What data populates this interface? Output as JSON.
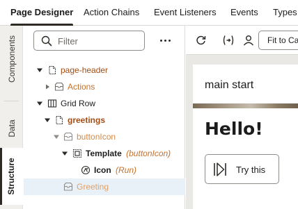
{
  "tabs": [
    {
      "label": "Page Designer",
      "active": true
    },
    {
      "label": "Action Chains",
      "active": false
    },
    {
      "label": "Event Listeners",
      "active": false
    },
    {
      "label": "Events",
      "active": false
    },
    {
      "label": "Types",
      "active": false
    }
  ],
  "rail": [
    {
      "label": "Components",
      "active": false
    },
    {
      "label": "Data",
      "active": false
    },
    {
      "label": "Structure",
      "active": true
    }
  ],
  "filter": {
    "placeholder": "Filter",
    "value": ""
  },
  "more_icon": "ellipsis-icon",
  "tree": [
    {
      "label": "page-header",
      "sub": "",
      "icon": "page-icon",
      "toggle": "expanded",
      "style": "orange-bold"
    },
    {
      "label": "Actions",
      "sub": "",
      "icon": "slot-icon",
      "toggle": "collapsed",
      "style": "orange"
    },
    {
      "label": "Grid Row",
      "sub": "",
      "icon": "grid-row-icon",
      "toggle": "expanded",
      "style": "dark"
    },
    {
      "label": "greetings",
      "sub": "",
      "icon": "page-icon",
      "toggle": "expanded",
      "style": "orange-bold"
    },
    {
      "label": "buttonIcon",
      "sub": "",
      "icon": "slot-icon",
      "toggle": "expanded",
      "style": "orange-light"
    },
    {
      "label": "Template",
      "sub": "(buttonIcon)",
      "icon": "template-icon",
      "toggle": "expanded",
      "style": "dark-bold"
    },
    {
      "label": "Icon",
      "sub": "(Run)",
      "icon": "icon-component-icon",
      "toggle": "none",
      "style": "dark-bold"
    },
    {
      "label": "Greeting",
      "sub": "",
      "icon": "slot-icon",
      "toggle": "none",
      "style": "orange-pale",
      "selected": true
    }
  ],
  "toolbar": {
    "refresh_icon": "refresh-icon",
    "variables_icon": "variables-icon",
    "user_icon": "user-icon",
    "fit_label": "Fit to Canvas"
  },
  "preview": {
    "header_text": "main start",
    "hello_text": "Hello!",
    "button_label": "Try this",
    "button_icon": "run-icon"
  },
  "colors": {
    "accent_orange": "#c4722c",
    "selected_row": "#e9f1f8",
    "tab_underline": "#2d2a26"
  }
}
